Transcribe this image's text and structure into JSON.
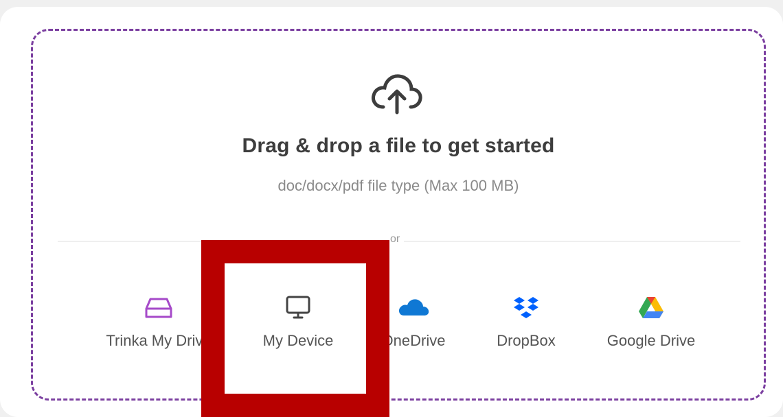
{
  "upload": {
    "title": "Drag & drop a file to get started",
    "subtitle": "doc/docx/pdf file type (Max 100 MB)",
    "divider_text": "or"
  },
  "sources": [
    {
      "label": "Trinka My Drive",
      "icon": "drive-tray-icon",
      "color": "#a64ac9"
    },
    {
      "label": "My Device",
      "icon": "monitor-icon",
      "color": "#444444"
    },
    {
      "label": "OneDrive",
      "icon": "onedrive-cloud-icon",
      "color": "#0f78d4"
    },
    {
      "label": "DropBox",
      "icon": "dropbox-icon",
      "color": "#0061fe"
    },
    {
      "label": "Google Drive",
      "icon": "google-drive-icon",
      "color": "#34a853"
    }
  ],
  "colors": {
    "dropzone_border": "#7b3fa0",
    "highlight": "#b80000"
  }
}
